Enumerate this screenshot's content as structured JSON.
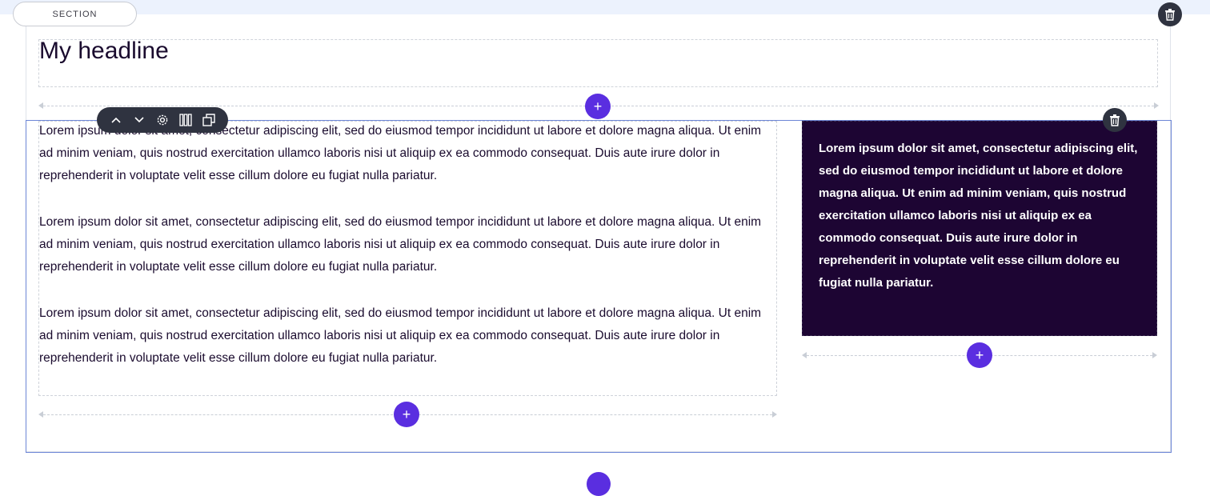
{
  "section": {
    "pill_label": "SECTION"
  },
  "headline": {
    "text": "My headline"
  },
  "left_column": {
    "paragraphs": [
      "Lorem ipsum dolor sit amet, consectetur adipiscing elit, sed do eiusmod tempor incididunt ut labore et dolore magna aliqua. Ut enim ad minim veniam, quis nostrud exercitation ullamco laboris nisi ut aliquip ex ea commodo consequat. Duis aute irure dolor in reprehenderit in voluptate velit esse cillum dolore eu fugiat nulla pariatur.",
      "Lorem ipsum dolor sit amet, consectetur adipiscing elit, sed do eiusmod tempor incididunt ut labore et dolore magna aliqua. Ut enim ad minim veniam, quis nostrud exercitation ullamco laboris nisi ut aliquip ex ea commodo consequat. Duis aute irure dolor in reprehenderit in voluptate velit esse cillum dolore eu fugiat nulla pariatur.",
      "Lorem ipsum dolor sit amet, consectetur adipiscing elit, sed do eiusmod tempor incididunt ut labore et dolore magna aliqua. Ut enim ad minim veniam, quis nostrud exercitation ullamco laboris nisi ut aliquip ex ea commodo consequat. Duis aute irure dolor in reprehenderit in voluptate velit esse cillum dolore eu fugiat nulla pariatur."
    ]
  },
  "right_column": {
    "card_text": "Lorem ipsum dolor sit amet, consectetur adipiscing elit, sed do eiusmod tempor incididunt ut labore et dolore magna aliqua. Ut enim ad minim veniam, quis nostrud exercitation ullamco laboris nisi ut aliquip ex ea commodo consequat. Duis aute irure dolor in reprehenderit in voluptate velit esse cillum dolore eu fugiat nulla pariatur."
  },
  "add_button": {
    "symbol": "+"
  },
  "toolbar": {
    "icons": [
      "chevron-up-icon",
      "chevron-down-icon",
      "gear-icon",
      "columns-icon",
      "duplicate-icon"
    ]
  },
  "colors": {
    "accent": "#5a2ee0",
    "dark_card": "#1d0533",
    "toolbar": "#2f3340",
    "row_outline": "#6d86d6",
    "band": "#ecf2fd"
  }
}
